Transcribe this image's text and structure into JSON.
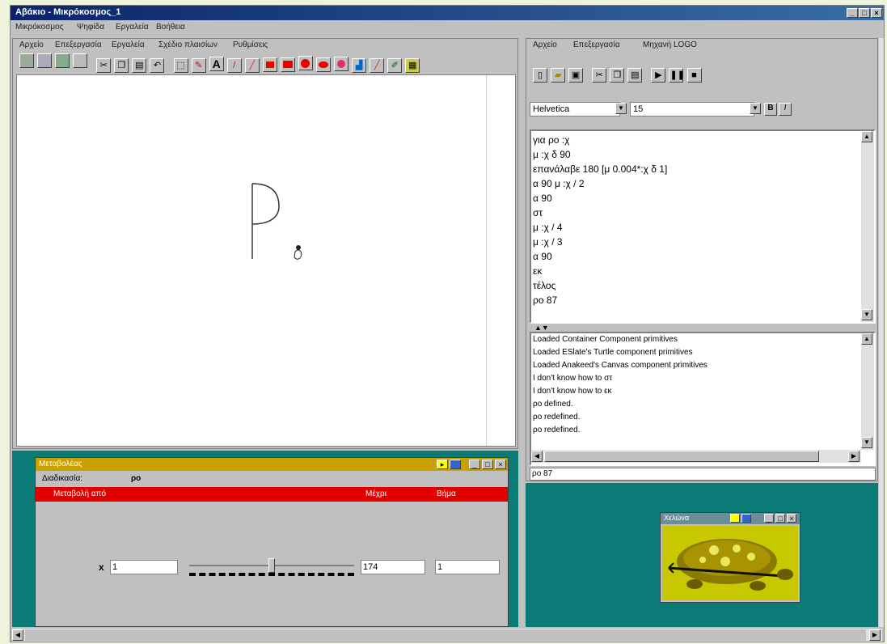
{
  "window": {
    "title": "Αβάκιο - Μικρόκοσμος_1",
    "controls": [
      "_",
      "□",
      "×"
    ]
  },
  "menubar": [
    "Μικρόκοσμος",
    "Ψηφίδα",
    "Εργαλεία",
    "Βοήθεια"
  ],
  "canvas_panel": {
    "menu": [
      "Αρχείο",
      "Επεξεργασία",
      "Εργαλεία",
      "Σχέδιο πλαισίων",
      "Ρυθμίσεις"
    ],
    "toolbar_icons": [
      "new-icon",
      "open-icon",
      "save-icon",
      "print-icon",
      "cut-icon",
      "copy-icon",
      "paste-icon",
      "undo-icon",
      "select-icon",
      "eraser-icon",
      "text-icon",
      "pen-icon",
      "line-icon",
      "rect-icon",
      "filled-rect-icon",
      "oval-icon",
      "filled-oval-icon",
      "circle-icon",
      "fill-icon",
      "brush-icon",
      "pencil-icon",
      "picture-icon"
    ],
    "text_tool_label": "A"
  },
  "logo_panel": {
    "menu": [
      "Αρχείο",
      "Επεξεργασία",
      "Μηχανή LOGO"
    ],
    "toolbar_icons": [
      "new-icon",
      "open-icon",
      "save-icon",
      "cut-icon",
      "copy-icon",
      "paste-icon",
      "run-icon",
      "pause-icon",
      "stop-icon"
    ],
    "font_name": "Helvetica",
    "font_size": "15",
    "bold_label": "B",
    "italic_label": "I",
    "code_lines": [
      "για ρο :χ",
      "μ :χ δ 90",
      "επανάλαβε 180 [μ 0.004*:χ δ 1]",
      "α 90 μ :χ / 2",
      "α 90",
      "στ",
      "μ :χ / 4",
      "μ :χ / 3",
      "α 90",
      "εκ",
      "τέλος",
      "",
      "ρο 87"
    ],
    "log_lines": [
      "Loaded Container Component primitives",
      "Loaded ESlate's Turtle component primitives",
      "Loaded Anakeed's Canvas component primitives",
      "I don't know how to στ",
      "I don't know how to εκ",
      "ρο defined.",
      "ρο redefined.",
      "ρο redefined."
    ],
    "command_input": "ρο 87"
  },
  "variables_window": {
    "title": "Μεταβολέας",
    "procedure_label": "Διαδικασία:",
    "procedure_value": "ρο",
    "columns": [
      "Μεταβολή από",
      "Μέχρι",
      "Βήμα"
    ],
    "var_name": "x",
    "from_value": "1",
    "to_value": "174",
    "step_value": "1",
    "slider_level": 0.5
  },
  "turtle_window": {
    "title": "Χελώνα"
  }
}
